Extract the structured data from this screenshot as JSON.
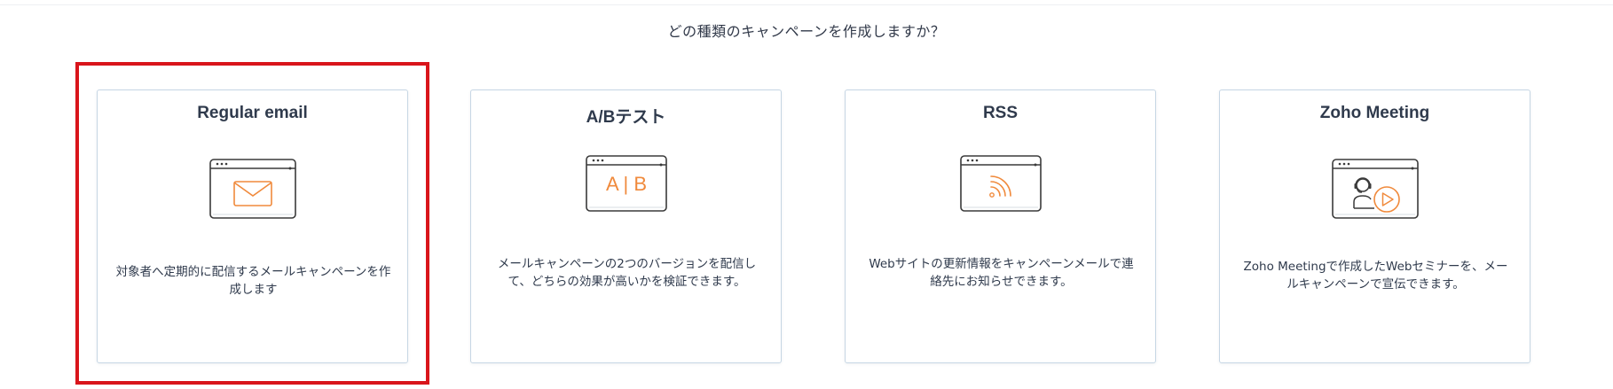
{
  "question": "どの種類のキャンペーンを作成しますか？",
  "cards": [
    {
      "title": "Regular email",
      "description": "対象者へ定期的に配信するメールキャンペーンを作成します",
      "icon": "envelope-icon"
    },
    {
      "title": "A/Bテスト",
      "description": "メールキャンペーンの2つのバージョンを配信して、どちらの効果が高いかを検証できます。",
      "icon": "ab-test-icon",
      "icon_text": "A | B"
    },
    {
      "title": "RSS",
      "description": "Webサイトの更新情報をキャンペーンメールで連絡先にお知らせできます。",
      "icon": "rss-icon"
    },
    {
      "title": "Zoho Meeting",
      "description": "Zoho Meetingで作成したWebセミナーを、メールキャンペーンで宣伝できます。",
      "icon": "webinar-icon"
    }
  ],
  "colors": {
    "accent_orange": "#f08a3c",
    "highlight_red": "#d9151b",
    "card_border": "#c6d6e4",
    "text": "#2f3a4c"
  }
}
